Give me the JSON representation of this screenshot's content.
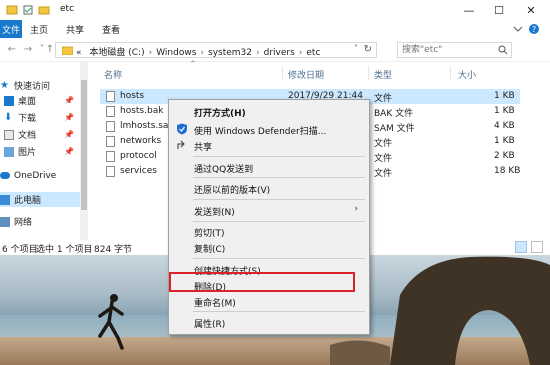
{
  "window": {
    "title": "etc",
    "controls": {
      "minimize": "—",
      "maximize": "☐",
      "close": "✕"
    }
  },
  "ribbon": {
    "tabs": [
      "文件",
      "主页",
      "共享",
      "查看"
    ]
  },
  "address": {
    "crumbs": [
      "本地磁盘 (C:)",
      "Windows",
      "system32",
      "drivers",
      "etc"
    ],
    "prefix": "«",
    "search_placeholder": "搜索\"etc\""
  },
  "nav": {
    "items": [
      {
        "label": "快速访问",
        "icon": "star-icon"
      },
      {
        "label": "桌面",
        "icon": "desktop-icon",
        "pinned": true
      },
      {
        "label": "下载",
        "icon": "download-icon",
        "pinned": true
      },
      {
        "label": "文档",
        "icon": "document-icon",
        "pinned": true
      },
      {
        "label": "图片",
        "icon": "picture-icon",
        "pinned": true
      },
      {
        "label": "OneDrive",
        "icon": "cloud-icon"
      },
      {
        "label": "此电脑",
        "icon": "computer-icon",
        "selected": true
      },
      {
        "label": "网络",
        "icon": "network-icon"
      }
    ]
  },
  "columns": {
    "name": "名称",
    "date": "修改日期",
    "type": "类型",
    "size": "大小"
  },
  "files": [
    {
      "name": "hosts",
      "date": "2017/9/29 21:44",
      "type": "文件",
      "size": "1 KB",
      "selected": true
    },
    {
      "name": "hosts.bak",
      "date": "",
      "type": "BAK 文件",
      "size": "1 KB"
    },
    {
      "name": "lmhosts.sam",
      "date": "",
      "type": "SAM 文件",
      "size": "4 KB"
    },
    {
      "name": "networks",
      "date": "",
      "type": "文件",
      "size": "1 KB"
    },
    {
      "name": "protocol",
      "date": "",
      "type": "文件",
      "size": "2 KB"
    },
    {
      "name": "services",
      "date": "",
      "type": "文件",
      "size": "18 KB"
    }
  ],
  "status": {
    "count": "6 个项目",
    "selection": "选中 1 个项目",
    "size": "824 字节"
  },
  "context_menu": {
    "open_with": "打开方式(H)",
    "defender": "使用 Windows Defender扫描...",
    "share": "共享",
    "send_qq": "通过QQ发送到",
    "restore": "还原以前的版本(V)",
    "send_to": "发送到(N)",
    "cut": "剪切(T)",
    "copy": "复制(C)",
    "shortcut": "创建快捷方式(S)",
    "delete": "删除(D)",
    "rename": "重命名(M)",
    "properties": "属性(R)",
    "submenu_arrow": "›"
  },
  "colors": {
    "accent": "#1979ca",
    "selection": "#cce8ff",
    "highlight_box": "#d8232a",
    "defender_shield": "#1e6fd0"
  }
}
